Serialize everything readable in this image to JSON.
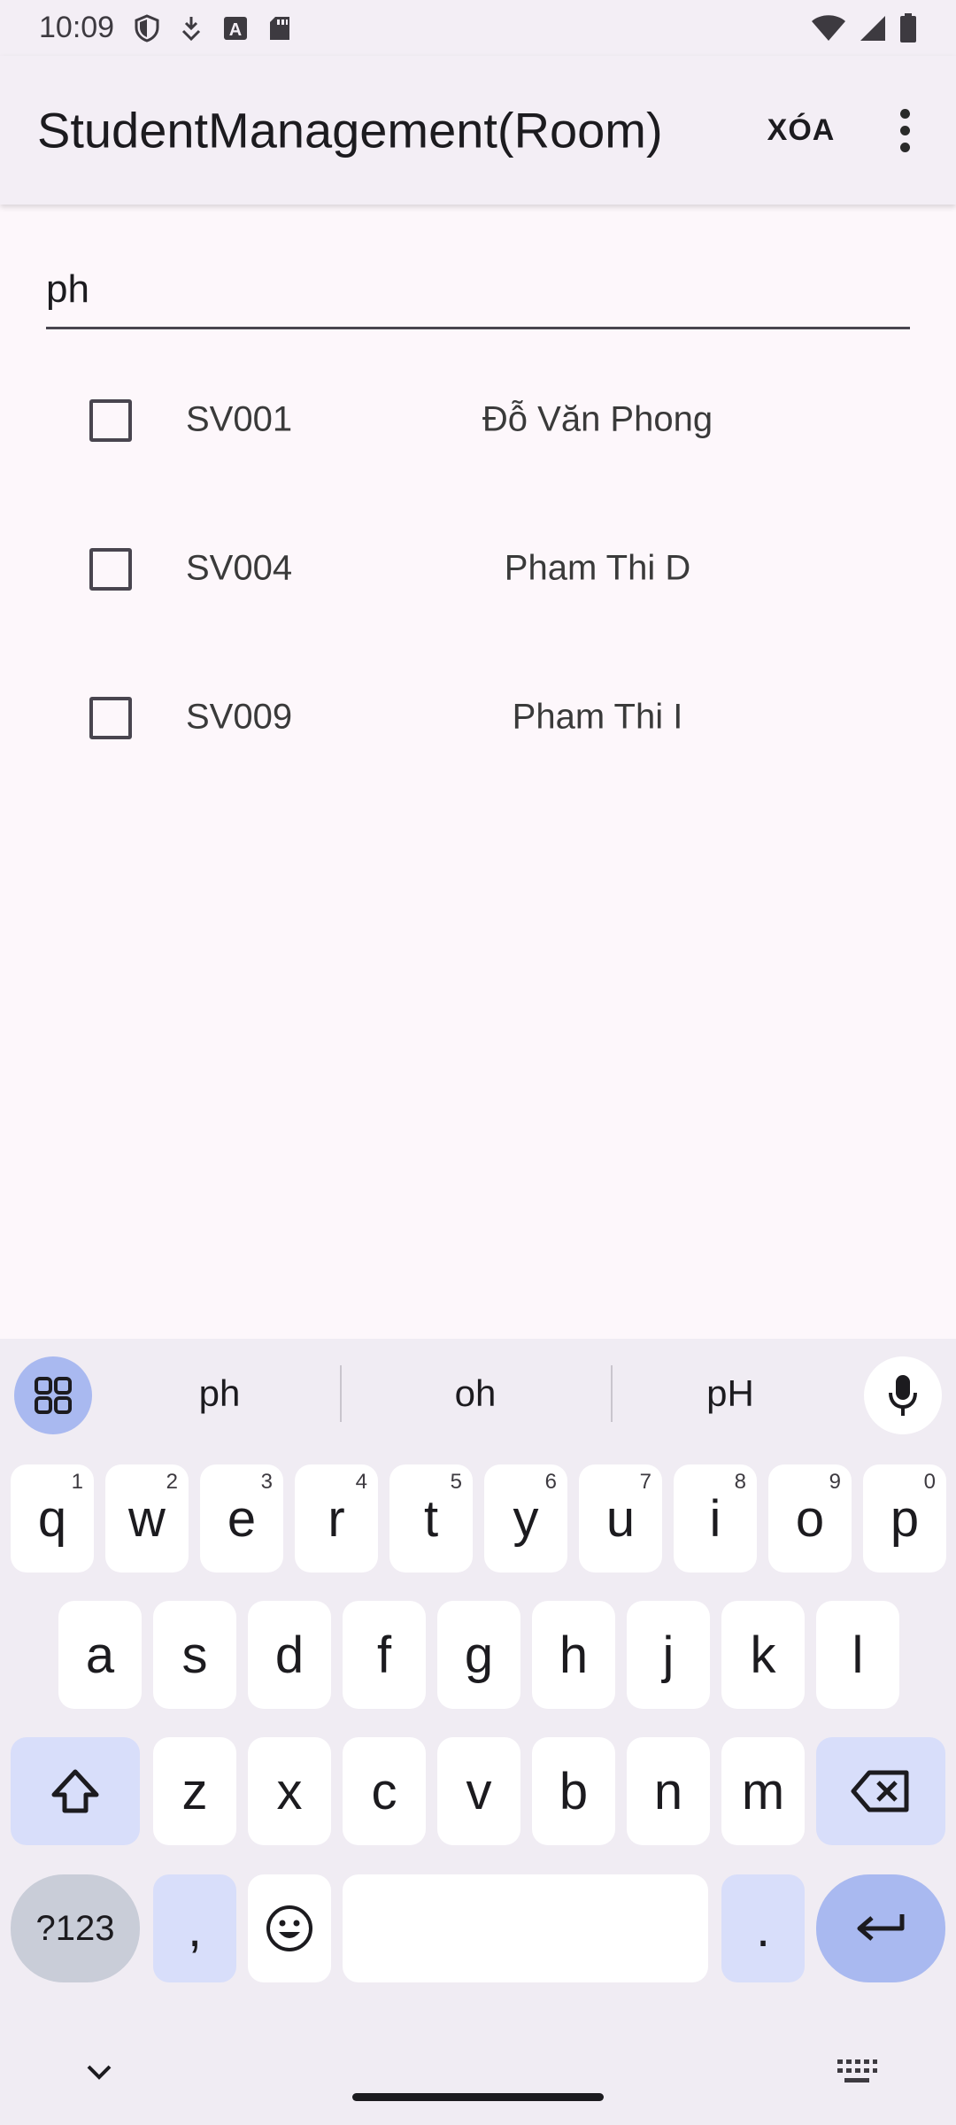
{
  "status_bar": {
    "time": "10:09",
    "left_icons": [
      "shield-icon",
      "download-icon",
      "font-a-icon",
      "sd-card-icon"
    ],
    "right_icons": [
      "wifi-icon",
      "signal-icon",
      "battery-icon"
    ]
  },
  "app_bar": {
    "title": "StudentManagement(Room)",
    "delete_label": "XÓA",
    "overflow_icon": "more-vert-icon"
  },
  "search": {
    "value": "ph"
  },
  "students": [
    {
      "id": "SV001",
      "name": "Đỗ Văn Phong",
      "checked": false
    },
    {
      "id": "SV004",
      "name": "Pham Thi D",
      "checked": false
    },
    {
      "id": "SV009",
      "name": "Pham Thi I",
      "checked": false
    }
  ],
  "keyboard": {
    "suggestions": [
      "ph",
      "oh",
      "pH"
    ],
    "row1": [
      {
        "k": "q",
        "h": "1"
      },
      {
        "k": "w",
        "h": "2"
      },
      {
        "k": "e",
        "h": "3"
      },
      {
        "k": "r",
        "h": "4"
      },
      {
        "k": "t",
        "h": "5"
      },
      {
        "k": "y",
        "h": "6"
      },
      {
        "k": "u",
        "h": "7"
      },
      {
        "k": "i",
        "h": "8"
      },
      {
        "k": "o",
        "h": "9"
      },
      {
        "k": "p",
        "h": "0"
      }
    ],
    "row2": [
      "a",
      "s",
      "d",
      "f",
      "g",
      "h",
      "j",
      "k",
      "l"
    ],
    "row3": [
      "z",
      "x",
      "c",
      "v",
      "b",
      "n",
      "m"
    ],
    "symbols_label": "?123",
    "comma_label": ",",
    "period_label": ".",
    "accent_color": "#a9b9f0"
  }
}
